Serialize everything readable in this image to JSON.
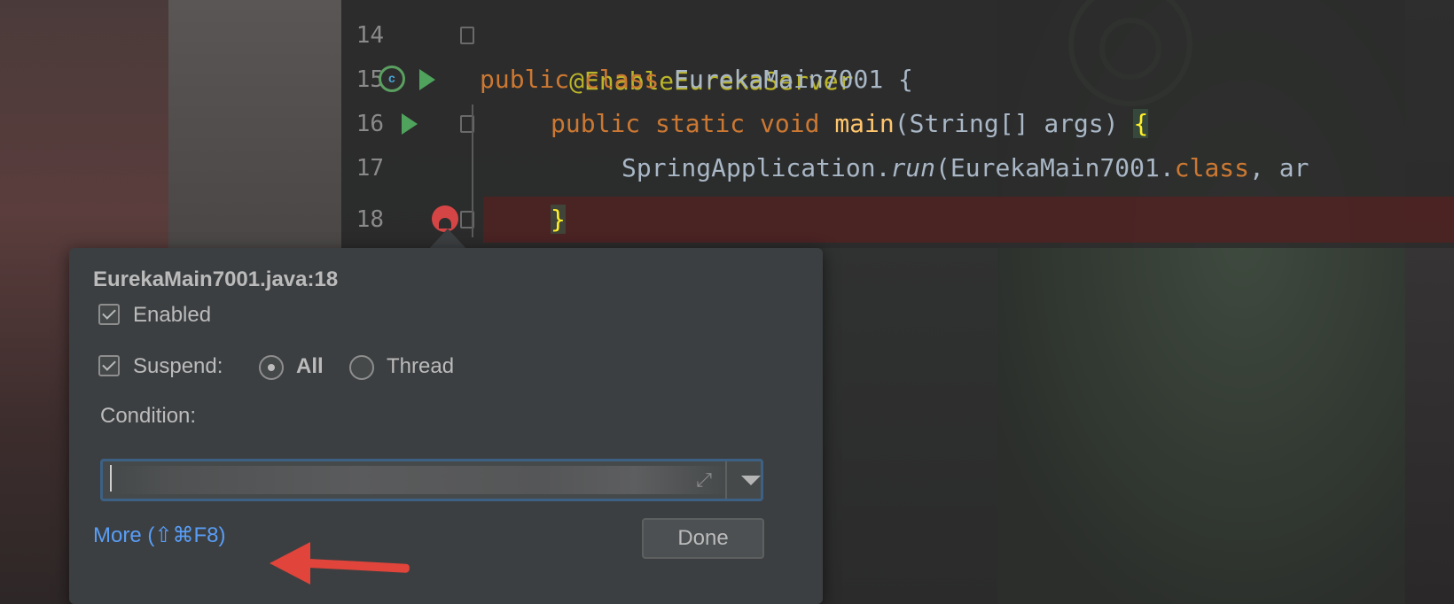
{
  "editor": {
    "lines": [
      {
        "num": "14",
        "annotation": "@EnableEurekaServer"
      },
      {
        "num": "15",
        "kw1": "public",
        "kw2": "class",
        "name": "EurekaMain7001",
        "brace": " {"
      },
      {
        "num": "16",
        "kw1": "public",
        "kw2": "static",
        "kw3": "void",
        "method": "main",
        "params": "(String[] args) ",
        "brace": "{"
      },
      {
        "num": "17",
        "obj": "SpringApplication.",
        "call": "run",
        "args1": "(EurekaMain7001.",
        "kw": "class",
        "args2": ", ar"
      },
      {
        "num": "18",
        "brace": "}"
      }
    ]
  },
  "popup": {
    "title": "EurekaMain7001.java:18",
    "enabled_label": "Enabled",
    "enabled_checked": true,
    "suspend_label": "Suspend:",
    "suspend_checked": true,
    "suspend_options": [
      {
        "label": "All",
        "selected": true
      },
      {
        "label": "Thread",
        "selected": false
      }
    ],
    "condition_label": "Condition:",
    "condition_value": "",
    "more_link": "More (⇧⌘F8)",
    "done_button": "Done"
  },
  "colors": {
    "accent_link": "#589df6",
    "breakpoint": "#d64545",
    "arrow": "#e0443a",
    "keyword": "#cc7832",
    "annotation": "#bbb529"
  }
}
